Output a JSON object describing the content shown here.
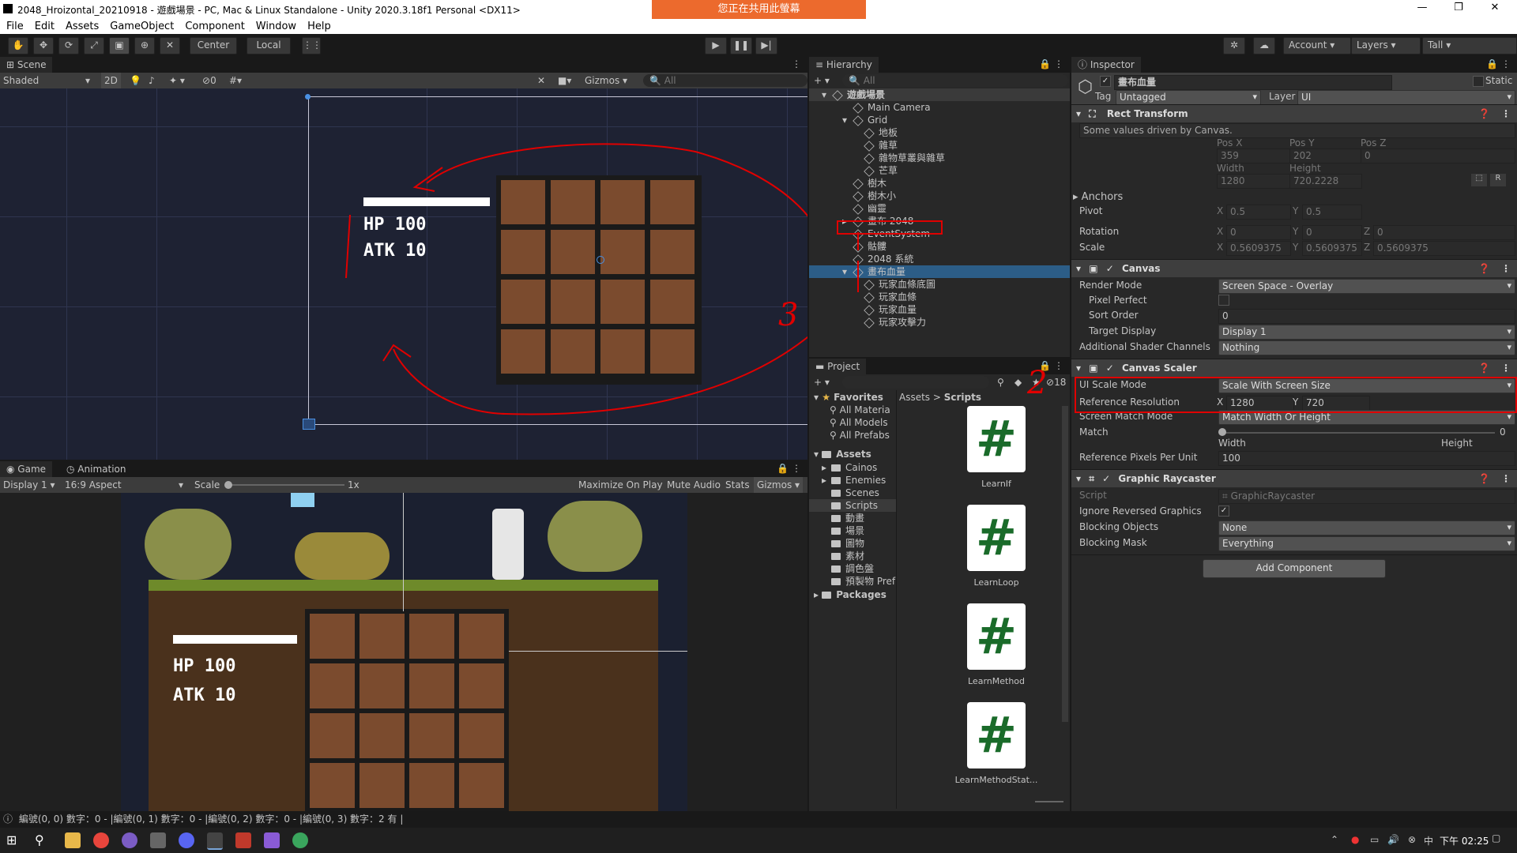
{
  "window": {
    "title": "2048_Hroizontal_20210918 - 遊戲場景 - PC, Mac & Linux Standalone - Unity 2020.3.18f1 Personal <DX11>",
    "share_banner": "您正在共用此螢幕"
  },
  "menu": [
    "File",
    "Edit",
    "Assets",
    "GameObject",
    "Component",
    "Window",
    "Help"
  ],
  "toolbar": {
    "pivot": "Center",
    "space": "Local",
    "account": "Account",
    "layers": "Layers",
    "layout": "Tall"
  },
  "scene": {
    "tab": "Scene",
    "shading": "Shaded",
    "mode2d": "2D",
    "gizmos": "Gizmos",
    "search_placeholder": "All",
    "vis_count": "0"
  },
  "game": {
    "tab_game": "Game",
    "tab_animation": "Animation",
    "display": "Display 1",
    "aspect": "16:9 Aspect",
    "scale_label": "Scale",
    "scale_value": "1x",
    "maximize": "Maximize On Play",
    "mute": "Mute Audio",
    "stats": "Stats",
    "gizmos": "Gizmos"
  },
  "hud": {
    "hp": "HP 100",
    "atk": "ATK 10"
  },
  "annotations": {
    "n1": "1",
    "n2": "2",
    "n3": "3"
  },
  "hierarchy": {
    "tab": "Hierarchy",
    "search_placeholder": "All",
    "items": [
      {
        "label": "遊戲場景",
        "depth": 0,
        "expanded": true,
        "scene": true
      },
      {
        "label": "Main Camera",
        "depth": 1
      },
      {
        "label": "Grid",
        "depth": 1,
        "expanded": true
      },
      {
        "label": "地板",
        "depth": 2
      },
      {
        "label": "雜草",
        "depth": 2
      },
      {
        "label": "雜物草叢與雜草",
        "depth": 2
      },
      {
        "label": "芒草",
        "depth": 2
      },
      {
        "label": "樹木",
        "depth": 1
      },
      {
        "label": "樹木小",
        "depth": 1
      },
      {
        "label": "幽靈",
        "depth": 1
      },
      {
        "label": "畫布 2048",
        "depth": 1,
        "collapsed": true
      },
      {
        "label": "EventSystem",
        "depth": 1
      },
      {
        "label": "骷髏",
        "depth": 1
      },
      {
        "label": "2048 系統",
        "depth": 1
      },
      {
        "label": "畫布血量",
        "depth": 1,
        "expanded": true,
        "selected": true
      },
      {
        "label": "玩家血條底圖",
        "depth": 2
      },
      {
        "label": "玩家血條",
        "depth": 2
      },
      {
        "label": "玩家血量",
        "depth": 2
      },
      {
        "label": "玩家攻擊力",
        "depth": 2
      }
    ]
  },
  "project": {
    "tab": "Project",
    "hidden_count": "18",
    "favorites_label": "Favorites",
    "favorites": [
      "All Materia",
      "All Models",
      "All Prefabs"
    ],
    "assets_label": "Assets",
    "assets": [
      "Cainos",
      "Enemies",
      "Scenes",
      "Scripts",
      "動畫",
      "場景",
      "圖物",
      "素材",
      "調色盤",
      "預製物 Pref"
    ],
    "packages_label": "Packages",
    "breadcrumb": [
      "Assets",
      "Scripts"
    ],
    "scripts": [
      "LearnIf",
      "LearnLoop",
      "LearnMethod",
      "LearnMethodStat..."
    ]
  },
  "inspector": {
    "tab": "Inspector",
    "object_name": "畫布血量",
    "static_label": "Static",
    "tag_label": "Tag",
    "tag": "Untagged",
    "layer_label": "Layer",
    "layer": "UI",
    "rect": {
      "title": "Rect Transform",
      "note": "Some values driven by Canvas.",
      "posx_label": "Pos X",
      "posy_label": "Pos Y",
      "posz_label": "Pos Z",
      "posx": "359",
      "posy": "202",
      "posz": "0",
      "width_label": "Width",
      "height_label": "Height",
      "width": "1280",
      "height": "720.2228",
      "anchors": "Anchors",
      "pivot_label": "Pivot",
      "pivot_x": "0.5",
      "pivot_y": "0.5",
      "rotation_label": "Rotation",
      "rot_x": "0",
      "rot_y": "0",
      "rot_z": "0",
      "scale_label": "Scale",
      "scale_x": "0.5609375",
      "scale_y": "0.5609375",
      "scale_z": "0.5609375"
    },
    "canvas": {
      "title": "Canvas",
      "render_mode_label": "Render Mode",
      "render_mode": "Screen Space - Overlay",
      "pixel_perfect_label": "Pixel Perfect",
      "sort_order_label": "Sort Order",
      "sort_order": "0",
      "target_display_label": "Target Display",
      "target_display": "Display 1",
      "shader_channels_label": "Additional Shader Channels",
      "shader_channels": "Nothing"
    },
    "scaler": {
      "title": "Canvas Scaler",
      "ui_scale_mode_label": "UI Scale Mode",
      "ui_scale_mode": "Scale With Screen Size",
      "ref_res_label": "Reference Resolution",
      "ref_x": "1280",
      "ref_y": "720",
      "match_mode_label": "Screen Match Mode",
      "match_mode": "Match Width Or Height",
      "match_label": "Match",
      "match_value": "0",
      "match_width": "Width",
      "match_height": "Height",
      "ppu_label": "Reference Pixels Per Unit",
      "ppu": "100"
    },
    "raycaster": {
      "title": "Graphic Raycaster",
      "script_label": "Script",
      "script": "GraphicRaycaster",
      "ignore_label": "Ignore Reversed Graphics",
      "blocking_objects_label": "Blocking Objects",
      "blocking_objects": "None",
      "blocking_mask_label": "Blocking Mask",
      "blocking_mask": "Everything"
    },
    "add_component": "Add Component"
  },
  "status": {
    "text": "編號(0, 0) 數字：0 - |編號(0, 1) 數字：0 - |編號(0, 2) 數字：0 - |編號(0, 3) 數字：2 有 |"
  },
  "taskbar": {
    "time": "下午 02:25"
  },
  "colors": {
    "accent_orange": "#ec6a2d",
    "selection_blue": "#2c5d87",
    "annotation_red": "#e00000",
    "tile_brown": "#7b4b2e"
  }
}
